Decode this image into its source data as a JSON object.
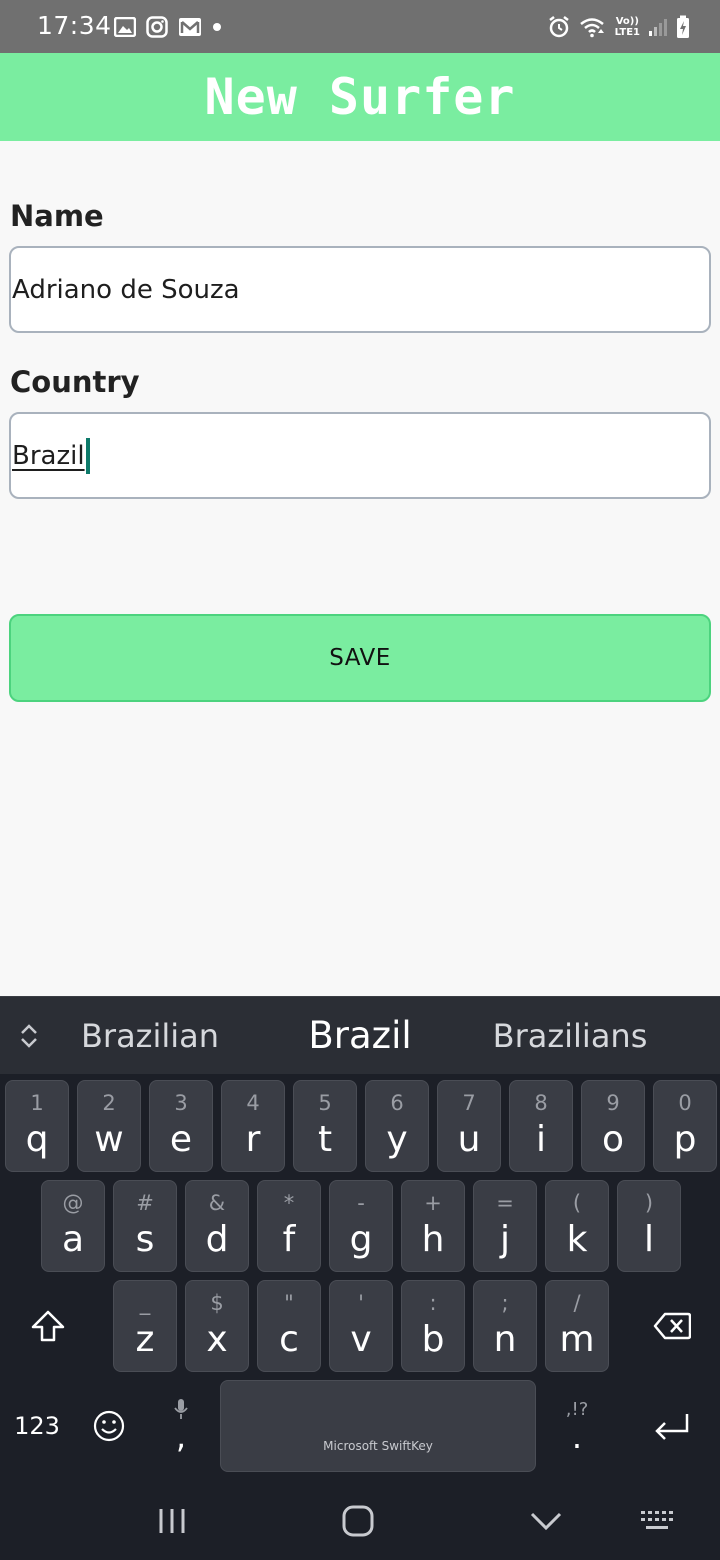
{
  "status_bar": {
    "time": "17:34",
    "left_icons": [
      "gallery-icon",
      "instagram-icon",
      "gmail-icon",
      "dot-icon"
    ],
    "right_icons": [
      "alarm-icon",
      "wifi-icon",
      "volte-lte-icon",
      "signal-icon",
      "battery-charging-icon"
    ],
    "volte_text": "Vo))",
    "lte_text": "LTE1"
  },
  "app_bar": {
    "title": "New Surfer",
    "background": "#7aeda0"
  },
  "form": {
    "name_label": "Name",
    "name_value": "Adriano de Souza",
    "country_label": "Country",
    "country_value": "Brazil",
    "save_label": "SAVE"
  },
  "keyboard": {
    "suggestions": [
      "Brazilian",
      "Brazil",
      "Brazilians"
    ],
    "row1": [
      {
        "hint": "1",
        "key": "q"
      },
      {
        "hint": "2",
        "key": "w"
      },
      {
        "hint": "3",
        "key": "e"
      },
      {
        "hint": "4",
        "key": "r"
      },
      {
        "hint": "5",
        "key": "t"
      },
      {
        "hint": "6",
        "key": "y"
      },
      {
        "hint": "7",
        "key": "u"
      },
      {
        "hint": "8",
        "key": "i"
      },
      {
        "hint": "9",
        "key": "o"
      },
      {
        "hint": "0",
        "key": "p"
      }
    ],
    "row2": [
      {
        "hint": "@",
        "key": "a"
      },
      {
        "hint": "#",
        "key": "s"
      },
      {
        "hint": "&",
        "key": "d"
      },
      {
        "hint": "*",
        "key": "f"
      },
      {
        "hint": "-",
        "key": "g"
      },
      {
        "hint": "+",
        "key": "h"
      },
      {
        "hint": "=",
        "key": "j"
      },
      {
        "hint": "(",
        "key": "k"
      },
      {
        "hint": ")",
        "key": "l"
      }
    ],
    "row3": [
      {
        "hint": "_",
        "key": "z"
      },
      {
        "hint": "$",
        "key": "x"
      },
      {
        "hint": "\"",
        "key": "c"
      },
      {
        "hint": "'",
        "key": "v"
      },
      {
        "hint": ":",
        "key": "b"
      },
      {
        "hint": ";",
        "key": "n"
      },
      {
        "hint": "/",
        "key": "m"
      }
    ],
    "numbers_key": "123",
    "comma_key": ",",
    "period_key": ".",
    "punct_hint": ",!?",
    "space_label": "Microsoft SwiftKey"
  }
}
